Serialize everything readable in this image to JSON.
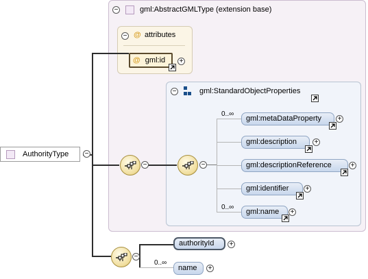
{
  "ext_base": {
    "label": "gml:AbstractGMLType (extension base)"
  },
  "attributes": {
    "label": "attributes",
    "items": [
      "gml:id"
    ]
  },
  "group": {
    "label": "gml:StandardObjectProperties"
  },
  "group_elements": [
    {
      "label": "gml:metaDataProperty",
      "cardinality": "0..∞"
    },
    {
      "label": "gml:description",
      "cardinality": ""
    },
    {
      "label": "gml:descriptionReference",
      "cardinality": ""
    },
    {
      "label": "gml:identifier",
      "cardinality": ""
    },
    {
      "label": "gml:name",
      "cardinality": "0..∞"
    }
  ],
  "root": {
    "label": "AuthorityType"
  },
  "local_elements": [
    {
      "label": "authorityId",
      "cardinality": ""
    },
    {
      "label": "name",
      "cardinality": "0..∞"
    }
  ],
  "symbols": {
    "at": "@",
    "minus": "−",
    "plus": "+"
  },
  "colors": {
    "ext_bg": "#f6f1f6",
    "attr_bg": "#fbf5e6",
    "group_bg": "#f1f4fa",
    "pill_border": "#8fa5c3",
    "compositor": "#f0dd9c"
  }
}
